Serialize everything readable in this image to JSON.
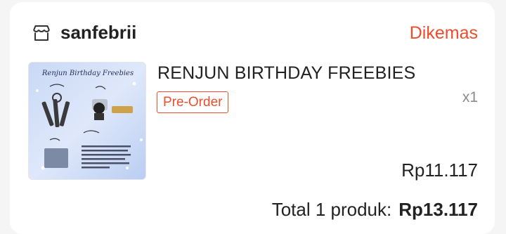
{
  "shop": {
    "icon": "shop-icon",
    "name": "sanfebrii"
  },
  "order": {
    "status": "Dikemas",
    "status_color": "#ee4d2d"
  },
  "product": {
    "name": "RENJUN BIRTHDAY FREEBIES",
    "tag": "Pre-Order",
    "quantity": "x1",
    "price": "Rp11.117",
    "image_title": "Renjun Birthday Freebies"
  },
  "summary": {
    "label": "Total 1 produk:",
    "amount": "Rp13.117"
  }
}
